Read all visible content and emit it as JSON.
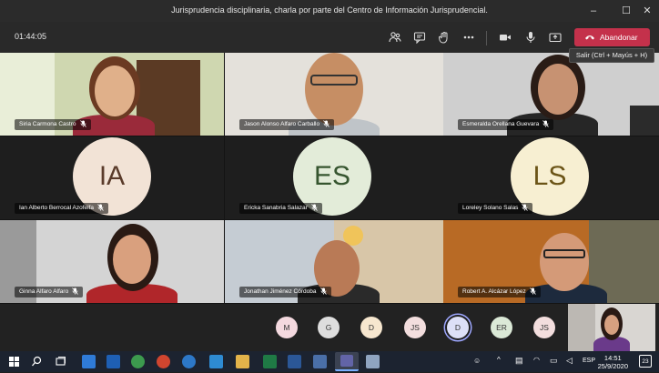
{
  "window": {
    "title": "Jurisprudencia disciplinaria, charla por parte del Centro de Información Jurisprudencial.",
    "minimize": "–",
    "maximize": "☐",
    "close": "✕"
  },
  "toolbar": {
    "timer": "01:44:05",
    "leave_label": "Abandonar",
    "leave_tooltip": "Salir (Ctrl + Mayús + H)"
  },
  "participants": [
    {
      "name": "Siria Carmona Castro",
      "kind": "video"
    },
    {
      "name": "Jason Alonso Alfaro Carballo",
      "kind": "video"
    },
    {
      "name": "Esmeralda Orellana Guevara",
      "kind": "video"
    },
    {
      "name": "Ian Alberto Berrocal Azofeifa",
      "kind": "avatar",
      "initials": "IA",
      "bg": "#f2e3d6",
      "fg": "#5a3b2a"
    },
    {
      "name": "Ericka Sanabria Salazar",
      "kind": "avatar",
      "initials": "ES",
      "bg": "#e3ecd9",
      "fg": "#36552f"
    },
    {
      "name": "Loreley Solano Salas",
      "kind": "avatar",
      "initials": "LS",
      "bg": "#f7efd2",
      "fg": "#6b5417"
    },
    {
      "name": "Ginna Alfaro Alfaro",
      "kind": "video"
    },
    {
      "name": "Jonathan Jiménez Córdoba",
      "kind": "video"
    },
    {
      "name": "Robert A. Alcázar López",
      "kind": "video"
    }
  ],
  "roster": [
    {
      "initials": "M",
      "bg": "#f4d9df"
    },
    {
      "initials": "G",
      "bg": "#dedede"
    },
    {
      "initials": "D",
      "bg": "#f7e7cf"
    },
    {
      "initials": "JS",
      "bg": "#f3dede"
    },
    {
      "initials": "D",
      "bg": "#dde0f7",
      "active": true
    },
    {
      "initials": "ER",
      "bg": "#dbe9d7"
    },
    {
      "initials": "JS",
      "bg": "#f3dede"
    }
  ],
  "taskbar": {
    "language": "ESP",
    "time": "14:51",
    "date": "25/9/2020",
    "notification_count": "23"
  },
  "colors": {
    "accent_leave": "#c4314b",
    "titlebar": "#2b2b2b",
    "taskbar": "#1c2330"
  }
}
